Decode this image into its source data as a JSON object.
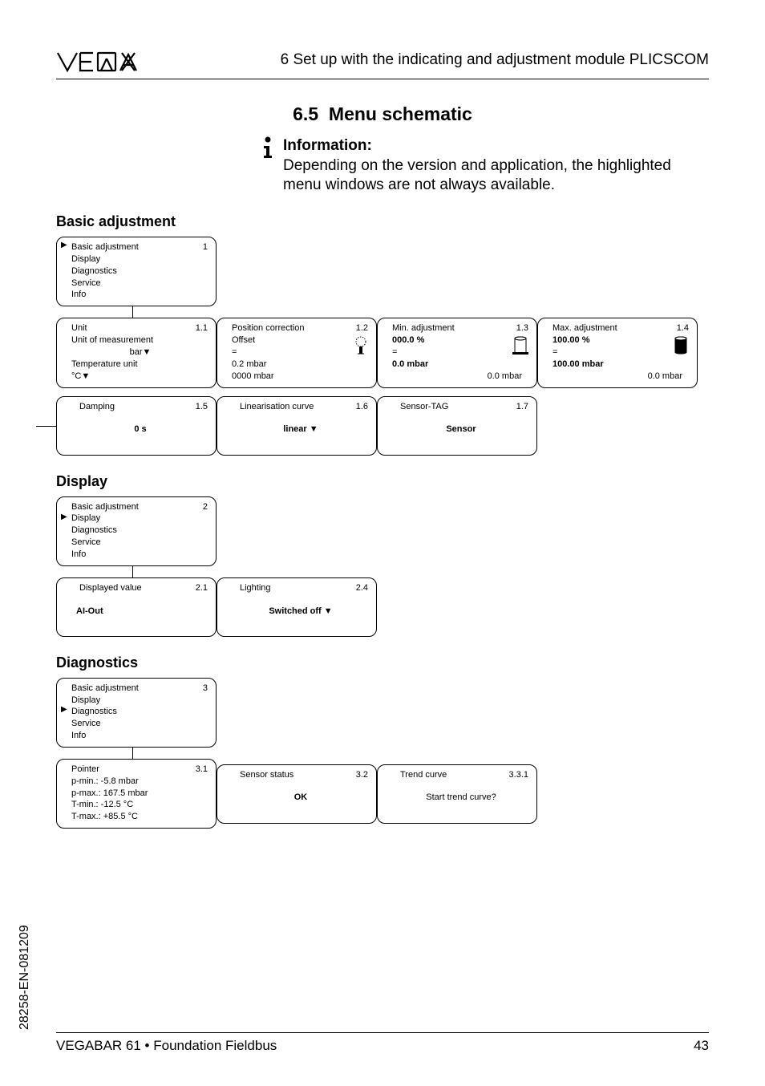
{
  "header": {
    "title": "6  Set up with the indicating and adjustment module PLICSCOM"
  },
  "section": {
    "number": "6.5",
    "title": "Menu schematic"
  },
  "info": {
    "heading": "Information:",
    "body": "Depending on the version and application, the highlighted menu windows are not always available."
  },
  "groups": {
    "basic": {
      "heading": "Basic adjustment",
      "main": {
        "num": "1",
        "items": [
          "Basic adjustment",
          "Display",
          "Diagnostics",
          "Service",
          "Info"
        ],
        "selected": 0
      },
      "r1": [
        {
          "num": "1.1",
          "l1": "Unit",
          "l2": "Unit of measurement",
          "l3": "bar▼",
          "l4": "Temperature unit",
          "l5": "°C▼"
        },
        {
          "num": "1.2",
          "l1": "Position correction",
          "l2": "Offset",
          "l3": "=",
          "l4": "0.2 mbar",
          "l5": "0000 mbar",
          "icon": "sensor"
        },
        {
          "num": "1.3",
          "l1": "Min. adjustment",
          "l2": "000.0 %",
          "l3": "=",
          "l4": "0.0 mbar",
          "l5": "0.0 mbar",
          "icon": "tank-open"
        },
        {
          "num": "1.4",
          "l1": "Max. adjustment",
          "l2": "100.00 %",
          "l3": "=",
          "l4": "100.00 mbar",
          "l5": "0.0 mbar",
          "icon": "tank-full"
        }
      ],
      "r2": [
        {
          "num": "1.5",
          "l1": "Damping",
          "val": "0 s"
        },
        {
          "num": "1.6",
          "l1": "Linearisation curve",
          "val": "linear ▼"
        },
        {
          "num": "1.7",
          "l1": "Sensor-TAG",
          "val": "Sensor"
        }
      ]
    },
    "display": {
      "heading": "Display",
      "main": {
        "num": "2",
        "items": [
          "Basic adjustment",
          "Display",
          "Diagnostics",
          "Service",
          "Info"
        ],
        "selected": 1
      },
      "r1": [
        {
          "num": "2.1",
          "l1": "Displayed value",
          "val": "AI-Out"
        },
        {
          "num": "2.4",
          "l1": "Lighting",
          "val": "Switched off ▼"
        }
      ]
    },
    "diag": {
      "heading": "Diagnostics",
      "main": {
        "num": "3",
        "items": [
          "Basic adjustment",
          "Display",
          "Diagnostics",
          "Service",
          "Info"
        ],
        "selected": 2
      },
      "r1": [
        {
          "num": "3.1",
          "l1": "Pointer",
          "l2": "p-min.: -5.8 mbar",
          "l3": "p-max.: 167.5 mbar",
          "l4": "T-min.: -12.5 °C",
          "l5": "T-max.: +85.5 °C"
        },
        {
          "num": "3.2",
          "l1": "Sensor status",
          "val": "OK"
        },
        {
          "num": "3.3.1",
          "l1": "Trend curve",
          "val": "Start trend curve?"
        }
      ]
    }
  },
  "footer": {
    "left": "VEGABAR 61 • Foundation Fieldbus",
    "right": "43"
  },
  "sidecode": "28258-EN-081209"
}
